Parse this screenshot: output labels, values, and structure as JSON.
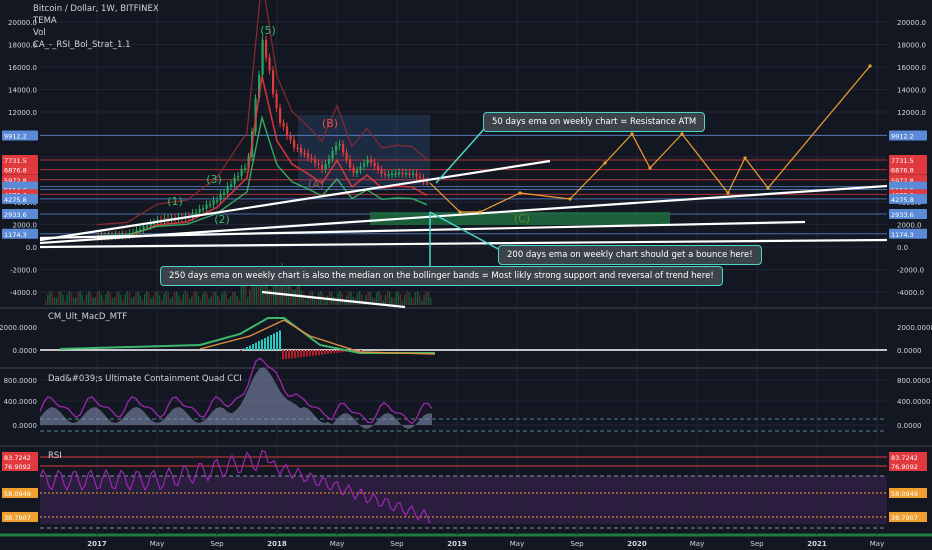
{
  "header": {
    "symbol": "Bitcoin / Dollar, 1W, BITFINEX",
    "indicators": [
      "TEMA",
      "Vol",
      "CA_-_RSI_Bol_Strat_1.1"
    ]
  },
  "panes": {
    "macd": {
      "title": "CM_Ult_MacD_MTF"
    },
    "cci": {
      "title": "Dad&#039;s Ultimate Containment Quad CCI"
    },
    "rsi": {
      "title": "RSI"
    }
  },
  "annotations": {
    "resistance": "50 days ema on weekly chart = Resistance ATM",
    "bounce": "200 days ema on weekly chart should get a bounce here!",
    "support": "250 days ema on weekly chart is also the median on the bollinger bands = Most likly strong support and reversal of trend here!"
  },
  "wave_labels": [
    "(1)",
    "(2)",
    "(3)",
    "(5)",
    "(B)",
    "(A)",
    "(C)"
  ],
  "colors": {
    "background": "#131722",
    "grid": "#232632",
    "text": "#d1d4dc",
    "bull": "#26a65b",
    "bear": "#e0393e",
    "callout_border": "#4dd6c8",
    "projection": "#f0a030",
    "blue_level": "#5b8ad6",
    "red_level": "#e0393e"
  },
  "chart_data": [
    {
      "type": "line",
      "title": "Bitcoin / Dollar, 1W, BITFINEX",
      "x_ticks": [
        "2017",
        "May",
        "Sep",
        "2018",
        "May",
        "Sep",
        "2019",
        "May",
        "Sep",
        "2020",
        "May",
        "Sep",
        "2021",
        "May"
      ],
      "y_ticks": [
        20000,
        18000,
        16000,
        14000,
        12000,
        10000,
        8000,
        6000,
        4000,
        2000,
        0,
        -2000,
        -4000
      ],
      "ylim": [
        -5000,
        21000
      ],
      "price_path": {
        "x": [
          "2017-01",
          "2017-03",
          "2017-05",
          "2017-07",
          "2017-09",
          "2017-11",
          "2017-12",
          "2018-01",
          "2018-02",
          "2018-03",
          "2018-04",
          "2018-05",
          "2018-06",
          "2018-07",
          "2018-08",
          "2018-09",
          "2018-10",
          "2018-11"
        ],
        "y": [
          950,
          1100,
          2400,
          2700,
          4300,
          7500,
          18500,
          11500,
          9000,
          8000,
          6900,
          9400,
          6500,
          7800,
          6400,
          6600,
          6500,
          5600
        ]
      },
      "level_labels": [
        {
          "value": "9912.2",
          "color": "#5b8ad6"
        },
        {
          "value": "7731.5",
          "color": "#e0393e"
        },
        {
          "value": "6876.8",
          "color": "#e0393e"
        },
        {
          "value": "5972.8",
          "color": "#e0393e"
        },
        {
          "value": "5368.5",
          "color": "#5b8ad6"
        },
        {
          "value": "5114.6",
          "color": "#5b8ad6"
        },
        {
          "value": "4673.6",
          "color": "#e0393e"
        },
        {
          "value": "4275.8",
          "color": "#5b8ad6"
        },
        {
          "value": "2933.6",
          "color": "#5b8ad6"
        },
        {
          "value": "1174.3",
          "color": "#5b8ad6"
        }
      ]
    },
    {
      "type": "line",
      "title": "CM_Ult_MacD_MTF",
      "y_ticks": [
        "2000.0000",
        "0.0000"
      ],
      "current_label": "0.0000"
    },
    {
      "type": "area",
      "title": "Dad&#039;s Ultimate Containment Quad CCI",
      "y_ticks": [
        "800.0000",
        "400.0000",
        "0.0000"
      ],
      "current_label": "0.0000"
    },
    {
      "type": "line",
      "title": "RSI",
      "y_ticks": [
        "83.7242",
        "76.9092",
        "58.0949",
        "38.7907"
      ],
      "label_colors": [
        "#e0393e",
        "#e0393e",
        "#f0a030",
        "#f0a030"
      ]
    }
  ]
}
